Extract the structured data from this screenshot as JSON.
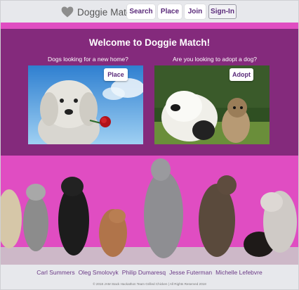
{
  "header": {
    "brand": "Doggie Match",
    "nav": {
      "search": "Search",
      "place": "Place",
      "join": "Join",
      "signin": "Sign-In"
    }
  },
  "hero": {
    "title": "Welcome to Doggie Match!",
    "place_card": {
      "caption": "Dogs looking for a new home?",
      "button": "Place"
    },
    "adopt_card": {
      "caption": "Are you looking to adopt a dog?",
      "button": "Adopt"
    }
  },
  "footer": {
    "names": [
      "Carl Summers",
      "Oleg Smolovyk",
      "Philip Dumaresq",
      "Jesse Futerman",
      "Michelle Lefebvre"
    ],
    "copyright": "© 2018 JAM Stack Hackathon Team Grilled Chicken | All Rights Reserved 2018"
  },
  "colors": {
    "header_bg": "#e7e8ec",
    "hero_bg": "#842a7c",
    "accent_text": "#5a2a7a",
    "wall_pink": "#e04dc2"
  },
  "icons": {
    "logo": "heart-icon"
  }
}
